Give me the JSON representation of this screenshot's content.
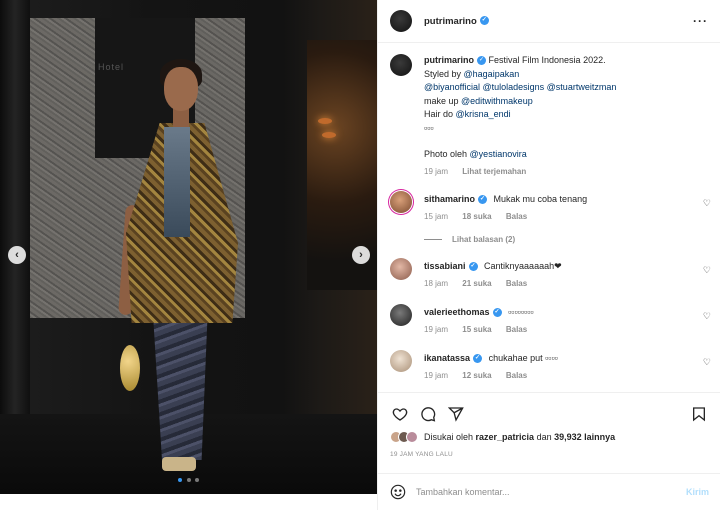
{
  "post": {
    "photo_sign": [
      "",
      "Hotel",
      ""
    ],
    "carousel": {
      "count": 3,
      "active": 0
    },
    "nav_prev": "‹",
    "nav_next": "›"
  },
  "header": {
    "username": "putrimarino",
    "more": "···"
  },
  "caption": {
    "username": "putrimarino",
    "text_line1": "Festival Film Indonesia 2022.",
    "line2_prefix": "Styled by ",
    "tag_stylist": "@hagaipakan",
    "tag_line3": "@biyanofficial @tuloladesigns @stuartweitzman",
    "line4_prefix": "make up ",
    "tag_makeup": "@editwithmakeup",
    "line5_prefix": "Hair do ",
    "tag_hair": "@krisna_endi",
    "emoji_line": "▫▫▫",
    "photo_prefix": "Photo oleh ",
    "tag_photo": "@yestianovira",
    "time": "19 jam",
    "translate": "Lihat terjemahan"
  },
  "comments": [
    {
      "username": "sithamarino",
      "text": "Mukak mu coba tenang",
      "time": "15 jam",
      "likes": "18 suka",
      "reply": "Balas",
      "replies": "Lihat balasan (2)",
      "avatar_color": "#b0704a"
    },
    {
      "username": "tissabiani",
      "text": "Cantiknyaaaaaah❤",
      "time": "18 jam",
      "likes": "21 suka",
      "reply": "Balas",
      "avatar_color": "#c79a86"
    },
    {
      "username": "valerieethomas",
      "text": "▫▫▫▫▫▫▫▫",
      "time": "19 jam",
      "likes": "15 suka",
      "reply": "Balas",
      "avatar_color": "#4a4a4a"
    },
    {
      "username": "ikanatassa",
      "text": "chukahae put ▫▫▫▫",
      "time": "19 jam",
      "likes": "12 suka",
      "reply": "Balas",
      "avatar_color": "#d9c7b5"
    }
  ],
  "likes": {
    "prefix": "Disukai oleh ",
    "user": "razer_patricia",
    "middle": " dan ",
    "count": "39,932 lainnya"
  },
  "time_ago": "19 JAM YANG LALU",
  "add_comment": {
    "placeholder": "Tambahkan komentar...",
    "post_label": "Kirim"
  },
  "icons": {
    "heart": "heart-icon",
    "comment": "comment-icon",
    "share": "share-icon",
    "bookmark": "bookmark-icon",
    "emoji": "emoji-icon"
  },
  "colors": {
    "verified": "#3897f0",
    "tag": "#00376b",
    "muted": "#8e8e8e",
    "post_button": "#b2dffc"
  }
}
